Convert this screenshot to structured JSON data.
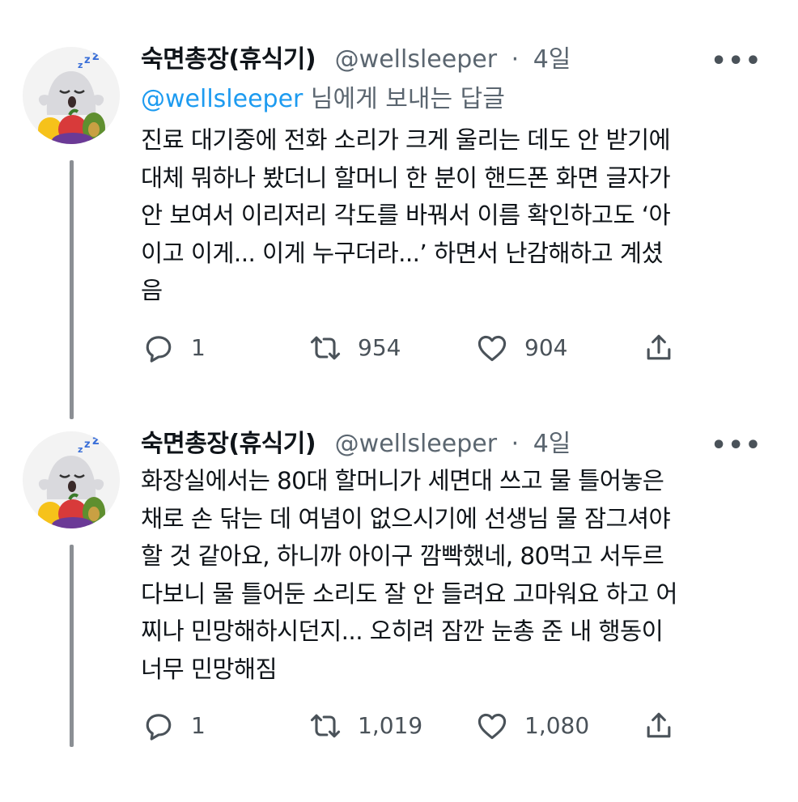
{
  "tweets": [
    {
      "author": {
        "name": "숙면총장(휴식기)",
        "handle": "@wellsleeper"
      },
      "separator": "·",
      "time": "4일",
      "more_label": "•••",
      "reply_to": {
        "mention": "@wellsleeper",
        "suffix": " 님에게 보내는 답글"
      },
      "lines": [
        "진료 대기중에 전화 소리가 크게 울리는 데도 안 받기에",
        "대체 뭐하나 봤더니 할머니 한 분이 핸드폰 화면 글자가",
        "안 보여서 이리저리 각도를 바꿔서 이름 확인하고도 ‘아",
        "이고 이게... 이게 누구더라...’ 하면서 난감해하고 계셨",
        "음"
      ],
      "stats": {
        "replies": "1",
        "retweets": "954",
        "likes": "904"
      }
    },
    {
      "author": {
        "name": "숙면총장(휴식기)",
        "handle": "@wellsleeper"
      },
      "separator": "·",
      "time": "4일",
      "more_label": "•••",
      "lines": [
        "화장실에서는 80대 할머니가 세면대 쓰고 물 틀어놓은",
        "채로 손 닦는 데 여념이 없으시기에 선생님 물 잠그셔야",
        "할 것 같아요, 하니까 아이구 깜빡했네, 80먹고 서두르",
        "다보니 물 틀어둔 소리도 잘 안 들려요 고마워요 하고 어",
        "찌나 민망해하시던지... 오히려 잠깐 눈총 준 내 행동이",
        "너무 민망해짐"
      ],
      "stats": {
        "replies": "1",
        "retweets": "1,019",
        "likes": "1,080"
      }
    }
  ],
  "icons": {
    "reply": "reply-icon",
    "retweet": "retweet-icon",
    "like": "heart-icon",
    "share": "share-icon",
    "avatar": "ghost-avatar"
  },
  "colors": {
    "text": "#0f1419",
    "muted": "#5b6670",
    "link": "#1d9bf0",
    "thread_line": "#8b8f94"
  }
}
